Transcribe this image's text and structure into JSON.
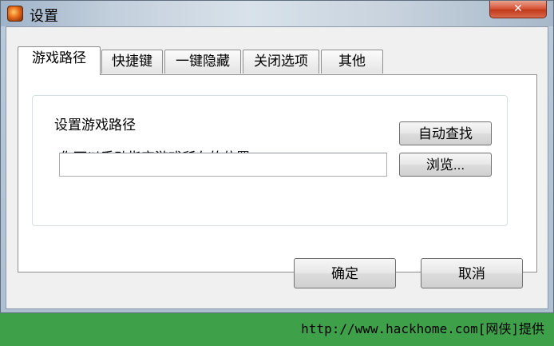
{
  "window": {
    "title": "设置",
    "close_glyph": "✕",
    "icon": "app-icon"
  },
  "tabs": [
    {
      "label": "游戏路径",
      "active": true
    },
    {
      "label": "快捷键",
      "active": false
    },
    {
      "label": "一键隐藏",
      "active": false
    },
    {
      "label": "关闭选项",
      "active": false
    },
    {
      "label": "其他",
      "active": false
    }
  ],
  "game_path": {
    "group_title": "设置游戏路径",
    "hint": "你可以手动指定游戏所在的位置",
    "path_value": "",
    "auto_find_label": "自动查找",
    "browse_label": "浏览..."
  },
  "dialog": {
    "ok_label": "确定",
    "cancel_label": "取消"
  },
  "footer": {
    "watermark": "http://www.hackhome.com[网侠]提供"
  },
  "colors": {
    "footer_bg": "#3fa04a",
    "close_button": "#d9573b",
    "active_tab_text": "#000000"
  }
}
